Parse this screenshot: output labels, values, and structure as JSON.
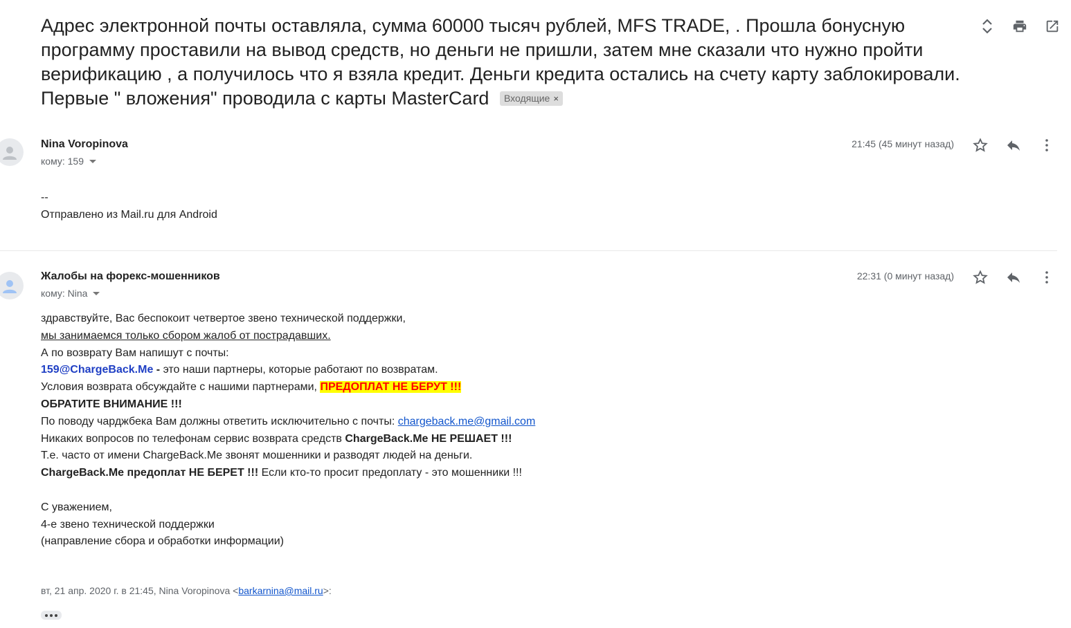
{
  "subject": {
    "text": "Адрес электронной почты оставляла, сумма 60000 тысяч рублей, MFS TRADE, . Прошла бонусную программу проставили на вывод средств, но деньги не пришли, затем мне сказали что нужно пройти верификацию , а получилось что я взяла кредит. Деньги кредита остались на счету карту заблокировали. Первые \" вложения\" проводила с карты MasterCard",
    "label": "Входящие",
    "label_remove": "×"
  },
  "toolbar": {
    "icons": [
      "expand-collapse-icon",
      "print-icon",
      "open-in-new-window-icon"
    ]
  },
  "messages": [
    {
      "sender": "Nina Voropinova",
      "to": "кому: 159",
      "time": "21:45 (45 минут назад)",
      "body": {
        "line1": "--",
        "line2": "Отправлено из Mail.ru для Android"
      }
    },
    {
      "sender": "Жалобы на форекс-мошенников",
      "to": "кому: Nina",
      "time": "22:31 (0 минут назад)",
      "body": {
        "l1": "здравствуйте, Вас беспокоит четвертое звено технической поддержки,",
        "l2": "мы занимаемся только сбором жалоб от пострадавших.",
        "l3": "А по возврату Вам напишут с почты:",
        "l4_email": "159@ChargeBack.Me",
        "l4_dash": " - ",
        "l4_rest": "это наши партнеры, которые работают по возвратам.",
        "l5_text": "Условия возврата обсуждайте с нашими партнерами, ",
        "l5_highlight": "ПРЕДОПЛАТ НЕ БЕРУТ !!!",
        "l6": "ОБРАТИТЕ ВНИМАНИЕ !!!",
        "l7_text": "По поводу чарджбека Вам должны ответить исключительно с почты: ",
        "l7_link": "chargeback.me@gmail.com",
        "l8_text": "Никаких вопросов по телефонам сервис возврата средств ",
        "l8_bold": "ChargeBack.Me НЕ РЕШАЕТ !!!",
        "l9": "Т.е. часто от имени ChargeBack.Me звонят мошенники и разводят людей на деньги.",
        "l10_bold": "ChargeBack.Me предоплат НЕ БЕРЕТ !!!",
        "l10_text": " Если кто-то просит предоплату - это мошенники !!!",
        "l11": "С уважением,",
        "l12": "4-е звено технической поддержки",
        "l13": "(направление сбора и обработки информации)"
      },
      "quote": {
        "prefix": "вт, 21 апр. 2020 г. в 21:45, Nina Voropinova <",
        "email": "barkarnina@mail.ru",
        "suffix": ">:"
      }
    }
  ]
}
